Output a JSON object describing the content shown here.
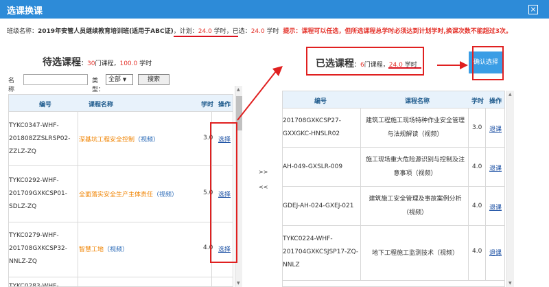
{
  "dialog": {
    "title": "选课换课",
    "close_label": "×"
  },
  "info": {
    "class_label": "班级名称：",
    "class_name": "2019年安管人员继续教育培训班(适用于ABC证)",
    "plan_label": "，计划：",
    "plan_value": "24.0",
    "hours_unit": "学时",
    "selected_label": "，已选：",
    "selected_value": "24.0",
    "tip": "提示：课程可以任选，但所选课程总学时必须达到计划学时,换课次数不能超过3次。"
  },
  "pending": {
    "heading": "待选课程",
    "count_prefix": "：",
    "count": "30",
    "count_unit": "门课程，",
    "hours": "100.0",
    "hours_unit": "学时"
  },
  "filter": {
    "name_label": "名称",
    "name_value": "",
    "type_label": "类型：",
    "type_value": "全部",
    "type_arrow": "▼",
    "search_label": "搜索"
  },
  "table_headers": {
    "code": "编号",
    "name": "课程名称",
    "hours": "学时",
    "action": "操作"
  },
  "pending_rows": [
    {
      "code": [
        "TYKC0347-WHF-",
        "201808ZZSLRSP02-",
        "ZZLZ-ZQ"
      ],
      "name": "深基坑工程安全控制",
      "video": "（视频）",
      "hours": "3.0",
      "action": "选择"
    },
    {
      "code": [
        "TYKC0292-WHF-",
        "201709GXKCSP01-",
        "SDLZ-ZQ"
      ],
      "name": "全面落实安全生产主体责任",
      "video": "（视频）",
      "hours": "5.0",
      "action": "选择"
    },
    {
      "code": [
        "TYKC0279-WHF-",
        "201708GXKCSP32-",
        "NNLZ-ZQ"
      ],
      "name": "智慧工地",
      "video": "（视频）",
      "hours": "4.0",
      "action": "选择"
    },
    {
      "code": [
        "TYKC0283-WHF-"
      ],
      "name": "",
      "video": "",
      "hours": "",
      "action": ""
    }
  ],
  "move": {
    "right": ">>",
    "left": "<<"
  },
  "selected": {
    "heading": "已选课程",
    "count_prefix": "：",
    "count": "6",
    "count_unit": "门课程，",
    "hours": "24.0",
    "hours_unit": "学时",
    "confirm_label": "确认选择"
  },
  "selected_rows": [
    {
      "code": [
        "201708GXKCSP27-",
        "GXXGKC-HNSLR02"
      ],
      "name": [
        "建筑工程施工现场特种作业安全管理",
        "与法规解读（视频）"
      ],
      "hours": "3.0",
      "action": "退课"
    },
    {
      "code": [
        "AH-049-GXSLR-009"
      ],
      "name": [
        "施工现场重大危险源识别与控制及注",
        "意事项（视频）"
      ],
      "hours": "4.0",
      "action": "退课"
    },
    {
      "code": [
        "GDEJ-AH-024-GXEJ-021"
      ],
      "name": [
        "建筑施工安全管理及事故案例分析",
        "（视频）"
      ],
      "hours": "4.0",
      "action": "退课"
    },
    {
      "code": [
        "TYKC0224-WHF-",
        "201704GXKCSJSP17-ZQ-",
        "NNLZ"
      ],
      "name": [
        "地下工程施工监测技术（视频）"
      ],
      "hours": "4.0",
      "action": "退课"
    }
  ],
  "colors": {
    "title_bar": "#2d8bd8",
    "header_bg": "#e8f2fb",
    "accent_red": "#e4332b",
    "annotation_red": "#e02020",
    "course_orange": "#f08300",
    "confirm_blue": "#3a9de5"
  }
}
